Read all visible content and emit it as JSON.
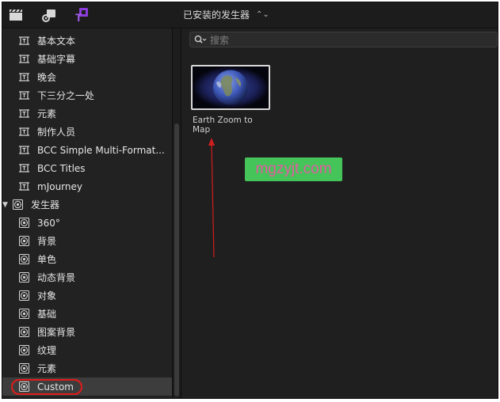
{
  "toolbar": {
    "icons": [
      "clapperboard-icon",
      "music-photo-icon",
      "titles-generators-icon"
    ],
    "generator_selector": "已安装的发生器",
    "accent_color": "#8b3bd9"
  },
  "sidebar": {
    "title_items": [
      {
        "label": "基本文本"
      },
      {
        "label": "基础字幕"
      },
      {
        "label": "晚会"
      },
      {
        "label": "下三分之一处"
      },
      {
        "label": "元素"
      },
      {
        "label": "制作人员"
      },
      {
        "label": "BCC Simple Multi-Format..."
      },
      {
        "label": "BCC Titles"
      },
      {
        "label": "mJourney"
      }
    ],
    "generators_group": {
      "label": "发生器",
      "expanded": true
    },
    "generator_items": [
      {
        "label": "360°"
      },
      {
        "label": "背景"
      },
      {
        "label": "单色"
      },
      {
        "label": "动态背景"
      },
      {
        "label": "对象"
      },
      {
        "label": "基础"
      },
      {
        "label": "图案背景"
      },
      {
        "label": "纹理"
      },
      {
        "label": "元素"
      },
      {
        "label": "Custom",
        "selected": true
      }
    ]
  },
  "content": {
    "search": {
      "placeholder": "搜索"
    },
    "items": [
      {
        "label": "Earth Zoom to Map"
      }
    ]
  },
  "overlay": {
    "watermark": "mgzyjt.com",
    "annotation_color": "#e11b1b"
  }
}
